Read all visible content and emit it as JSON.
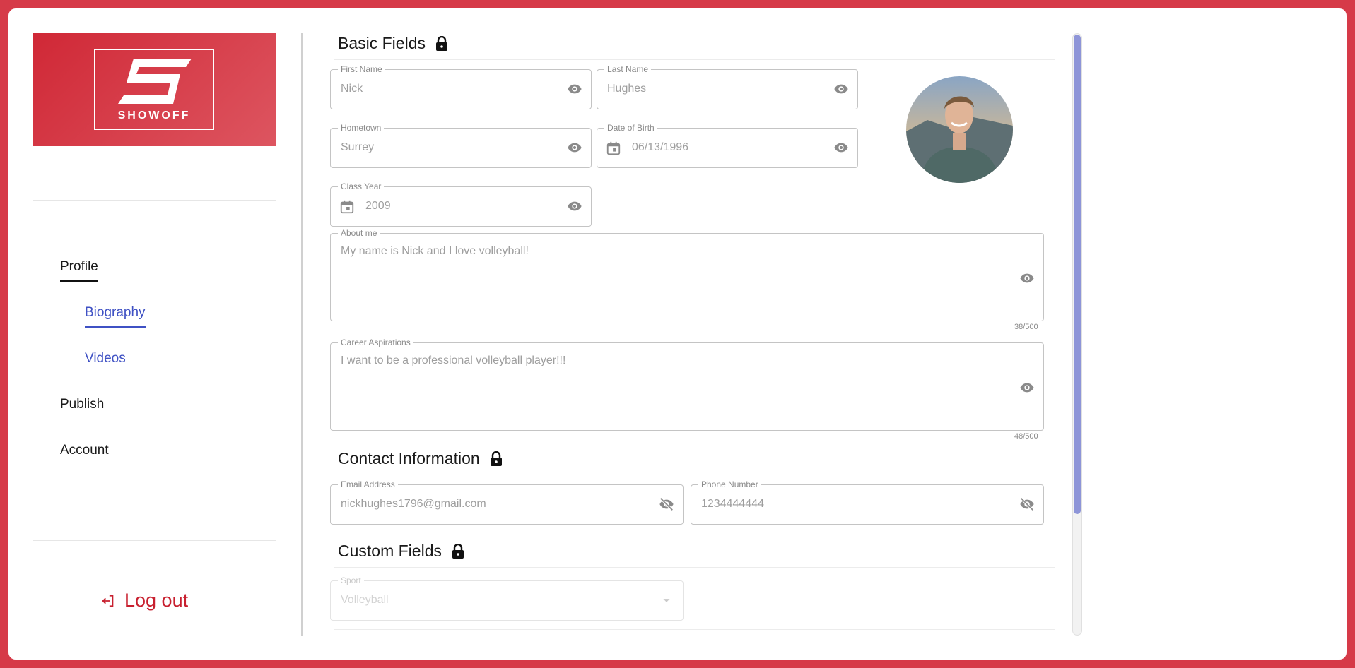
{
  "brand": {
    "name": "SHOWOFF",
    "accent": "#d63a48",
    "link": "#3f51c4"
  },
  "sidebar": {
    "nav": [
      {
        "label": "Profile",
        "level": 0,
        "state": "active-parent"
      },
      {
        "label": "Biography",
        "level": 1,
        "state": "active"
      },
      {
        "label": "Videos",
        "level": 1,
        "state": "default"
      },
      {
        "label": "Publish",
        "level": 0,
        "state": "default"
      },
      {
        "label": "Account",
        "level": 0,
        "state": "default"
      }
    ],
    "logout_label": "Log out",
    "logout_icon": "logout-icon"
  },
  "sections": {
    "basic": {
      "title": "Basic Fields",
      "icon": "lock-icon"
    },
    "contact": {
      "title": "Contact Information",
      "icon": "lock-icon"
    },
    "custom": {
      "title": "Custom Fields",
      "icon": "lock-icon"
    }
  },
  "fields": {
    "first_name": {
      "label": "First Name",
      "value": "Nick",
      "icon": "eye-icon"
    },
    "last_name": {
      "label": "Last Name",
      "value": "Hughes",
      "icon": "eye-icon"
    },
    "hometown": {
      "label": "Hometown",
      "value": "Surrey",
      "icon": "eye-icon"
    },
    "dob": {
      "label": "Date of Birth",
      "value": "06/13/1996",
      "icon": "eye-icon"
    },
    "class_year": {
      "label": "Class Year",
      "value": "2009",
      "icon": "eye-icon"
    },
    "about": {
      "label": "About me",
      "value": "My name is Nick and I love volleyball!",
      "counter": "38/500",
      "icon": "eye-icon"
    },
    "career": {
      "label": "Career Aspirations",
      "value": "I want to be a professional volleyball player!!!",
      "counter": "48/500",
      "icon": "eye-icon"
    },
    "email": {
      "label": "Email Address",
      "value": "nickhughes1796@gmail.com",
      "icon": "eye-off-icon"
    },
    "phone": {
      "label": "Phone Number",
      "value": "1234444444",
      "icon": "eye-off-icon"
    },
    "sport": {
      "label": "Sport",
      "value": "Volleyball",
      "icon": "chevron-down-icon"
    }
  },
  "scroll": {
    "position_fraction": 0.0,
    "visible_fraction": 0.8
  }
}
